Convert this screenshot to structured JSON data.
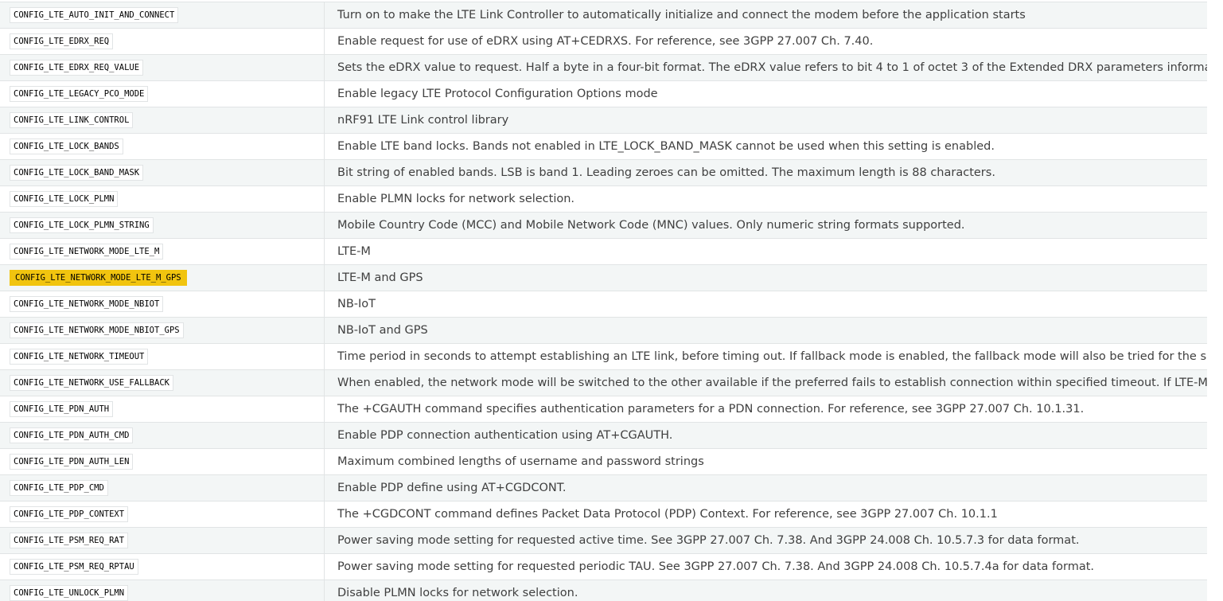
{
  "options": [
    {
      "name": "CONFIG_LTE_AUTO_INIT_AND_CONNECT",
      "description": "Turn on to make the LTE Link Controller to automatically initialize and connect the modem before the application starts",
      "highlighted": false
    },
    {
      "name": "CONFIG_LTE_EDRX_REQ",
      "description": "Enable request for use of eDRX using AT+CEDRXS. For reference, see 3GPP 27.007 Ch. 7.40.",
      "highlighted": false
    },
    {
      "name": "CONFIG_LTE_EDRX_REQ_VALUE",
      "description": "Sets the eDRX value to request. Half a byte in a four-bit format. The eDRX value refers to bit 4 to 1 of octet 3 of the Extended DRX parameters information element. S",
      "highlighted": false
    },
    {
      "name": "CONFIG_LTE_LEGACY_PCO_MODE",
      "description": "Enable legacy LTE Protocol Configuration Options mode",
      "highlighted": false
    },
    {
      "name": "CONFIG_LTE_LINK_CONTROL",
      "description": "nRF91 LTE Link control library",
      "highlighted": false
    },
    {
      "name": "CONFIG_LTE_LOCK_BANDS",
      "description": "Enable LTE band locks. Bands not enabled in LTE_LOCK_BAND_MASK cannot be used when this setting is enabled.",
      "highlighted": false
    },
    {
      "name": "CONFIG_LTE_LOCK_BAND_MASK",
      "description": "Bit string of enabled bands. LSB is band 1. Leading zeroes can be omitted. The maximum length is 88 characters.",
      "highlighted": false
    },
    {
      "name": "CONFIG_LTE_LOCK_PLMN",
      "description": "Enable PLMN locks for network selection.",
      "highlighted": false
    },
    {
      "name": "CONFIG_LTE_LOCK_PLMN_STRING",
      "description": "Mobile Country Code (MCC) and Mobile Network Code (MNC) values. Only numeric string formats supported.",
      "highlighted": false
    },
    {
      "name": "CONFIG_LTE_NETWORK_MODE_LTE_M",
      "description": "LTE-M",
      "highlighted": false
    },
    {
      "name": "CONFIG_LTE_NETWORK_MODE_LTE_M_GPS",
      "description": "LTE-M and GPS",
      "highlighted": true
    },
    {
      "name": "CONFIG_LTE_NETWORK_MODE_NBIOT",
      "description": "NB-IoT",
      "highlighted": false
    },
    {
      "name": "CONFIG_LTE_NETWORK_MODE_NBIOT_GPS",
      "description": "NB-IoT and GPS",
      "highlighted": false
    },
    {
      "name": "CONFIG_LTE_NETWORK_TIMEOUT",
      "description": "Time period in seconds to attempt establishing an LTE link, before timing out. If fallback mode is enabled, the fallback mode will also be tried for the same period.",
      "highlighted": false
    },
    {
      "name": "CONFIG_LTE_NETWORK_USE_FALLBACK",
      "description": "When enabled, the network mode will be switched to the other available if the preferred fails to establish connection within specified timeout. If LTE-M is selected as t",
      "highlighted": false
    },
    {
      "name": "CONFIG_LTE_PDN_AUTH",
      "description": "The +CGAUTH command specifies authentication parameters for a PDN connection. For reference, see 3GPP 27.007 Ch. 10.1.31.",
      "highlighted": false
    },
    {
      "name": "CONFIG_LTE_PDN_AUTH_CMD",
      "description": "Enable PDP connection authentication using AT+CGAUTH.",
      "highlighted": false
    },
    {
      "name": "CONFIG_LTE_PDN_AUTH_LEN",
      "description": "Maximum combined lengths of username and password strings",
      "highlighted": false
    },
    {
      "name": "CONFIG_LTE_PDP_CMD",
      "description": "Enable PDP define using AT+CGDCONT.",
      "highlighted": false
    },
    {
      "name": "CONFIG_LTE_PDP_CONTEXT",
      "description": "The +CGDCONT command defines Packet Data Protocol (PDP) Context. For reference, see 3GPP 27.007 Ch. 10.1.1",
      "highlighted": false
    },
    {
      "name": "CONFIG_LTE_PSM_REQ_RAT",
      "description": "Power saving mode setting for requested active time. See 3GPP 27.007 Ch. 7.38. And 3GPP 24.008 Ch. 10.5.7.3 for data format.",
      "highlighted": false
    },
    {
      "name": "CONFIG_LTE_PSM_REQ_RPTAU",
      "description": "Power saving mode setting for requested periodic TAU. See 3GPP 27.007 Ch. 7.38. And 3GPP 24.008 Ch. 10.5.7.4a for data format.",
      "highlighted": false
    },
    {
      "name": "CONFIG_LTE_UNLOCK_PLMN",
      "description": "Disable PLMN locks for network selection.",
      "highlighted": false
    }
  ],
  "colors": {
    "highlight": "#f1c40f",
    "row_alt": "#f3f6f6",
    "text": "#404040"
  }
}
